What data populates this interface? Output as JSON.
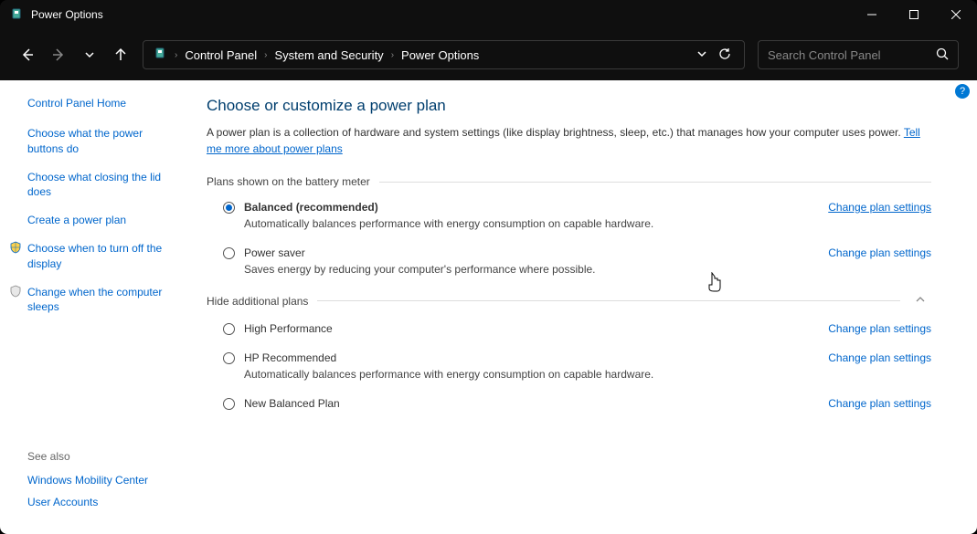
{
  "titlebar": {
    "title": "Power Options"
  },
  "breadcrumbs": [
    "Control Panel",
    "System and Security",
    "Power Options"
  ],
  "search": {
    "placeholder": "Search Control Panel"
  },
  "help": {
    "label": "?"
  },
  "sidebar": {
    "home": "Control Panel Home",
    "links": [
      "Choose what the power buttons do",
      "Choose what closing the lid does",
      "Create a power plan",
      "Choose when to turn off the display",
      "Change when the computer sleeps"
    ],
    "see_also_title": "See also",
    "see_also": [
      "Windows Mobility Center",
      "User Accounts"
    ]
  },
  "main": {
    "title": "Choose or customize a power plan",
    "desc": "A power plan is a collection of hardware and system settings (like display brightness, sleep, etc.) that manages how your computer uses power. ",
    "desc_link": "Tell me more about power plans",
    "section1_title": "Plans shown on the battery meter",
    "section2_title": "Hide additional plans",
    "change_link": "Change plan settings",
    "plans_primary": [
      {
        "name": "Balanced (recommended)",
        "desc": "Automatically balances performance with energy consumption on capable hardware.",
        "checked": true,
        "bold": true,
        "link_active": true
      },
      {
        "name": "Power saver",
        "desc": "Saves energy by reducing your computer's performance where possible.",
        "checked": false,
        "bold": false,
        "link_active": false
      }
    ],
    "plans_additional": [
      {
        "name": "High Performance",
        "desc": "",
        "checked": false
      },
      {
        "name": "HP Recommended",
        "desc": "Automatically balances performance with energy consumption on capable hardware.",
        "checked": false
      },
      {
        "name": "New Balanced Plan",
        "desc": "",
        "checked": false
      }
    ]
  }
}
